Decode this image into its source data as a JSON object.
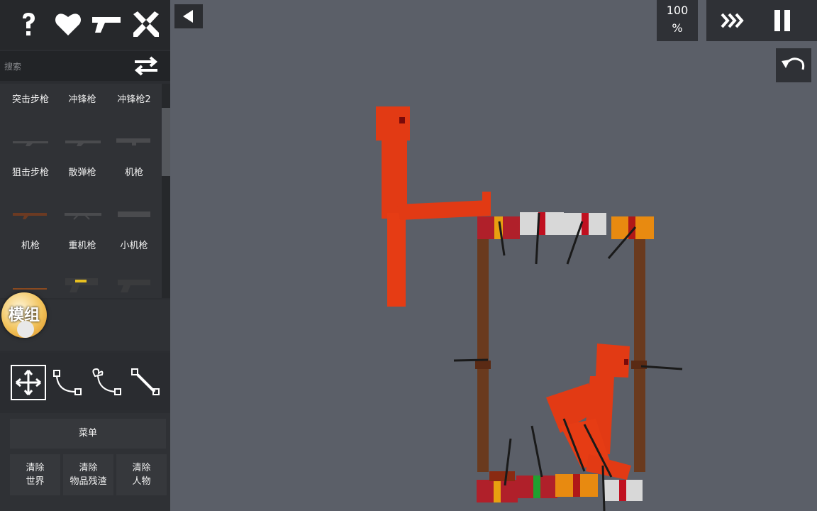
{
  "sidebar": {
    "top_icons": [
      "help-icon",
      "heart-icon",
      "gun-icon",
      "crossed-swords-icon"
    ],
    "search_placeholder": "搜索",
    "categories": [
      {
        "label": "突击步枪"
      },
      {
        "label": "冲锋枪"
      },
      {
        "label": "冲锋枪2"
      },
      {
        "label": "狙击步枪"
      },
      {
        "label": "散弹枪"
      },
      {
        "label": "机枪"
      },
      {
        "label": "机枪"
      },
      {
        "label": "重机枪"
      },
      {
        "label": "小机枪"
      }
    ],
    "mod_button_label": "模组",
    "tools": [
      "move-tool-icon",
      "rope-tool-icon",
      "spring-tool-icon",
      "rod-tool-icon"
    ],
    "menu_label": "菜单",
    "clear_buttons": [
      {
        "line1": "清除",
        "line2": "世界"
      },
      {
        "line1": "清除",
        "line2": "物品残渣"
      },
      {
        "line1": "清除",
        "line2": "人物"
      }
    ]
  },
  "hud": {
    "zoom_value": "100",
    "zoom_unit": "%",
    "fast_forward_icon": "fast-forward-icon",
    "pause_icon": "pause-icon",
    "undo_icon": "undo-icon",
    "collapse_icon": "play-left-icon"
  },
  "colors": {
    "background": "#5b5f68",
    "ragdoll": "#e23a14",
    "pole": "#6a3a1e",
    "panel": "#2b2d31"
  }
}
